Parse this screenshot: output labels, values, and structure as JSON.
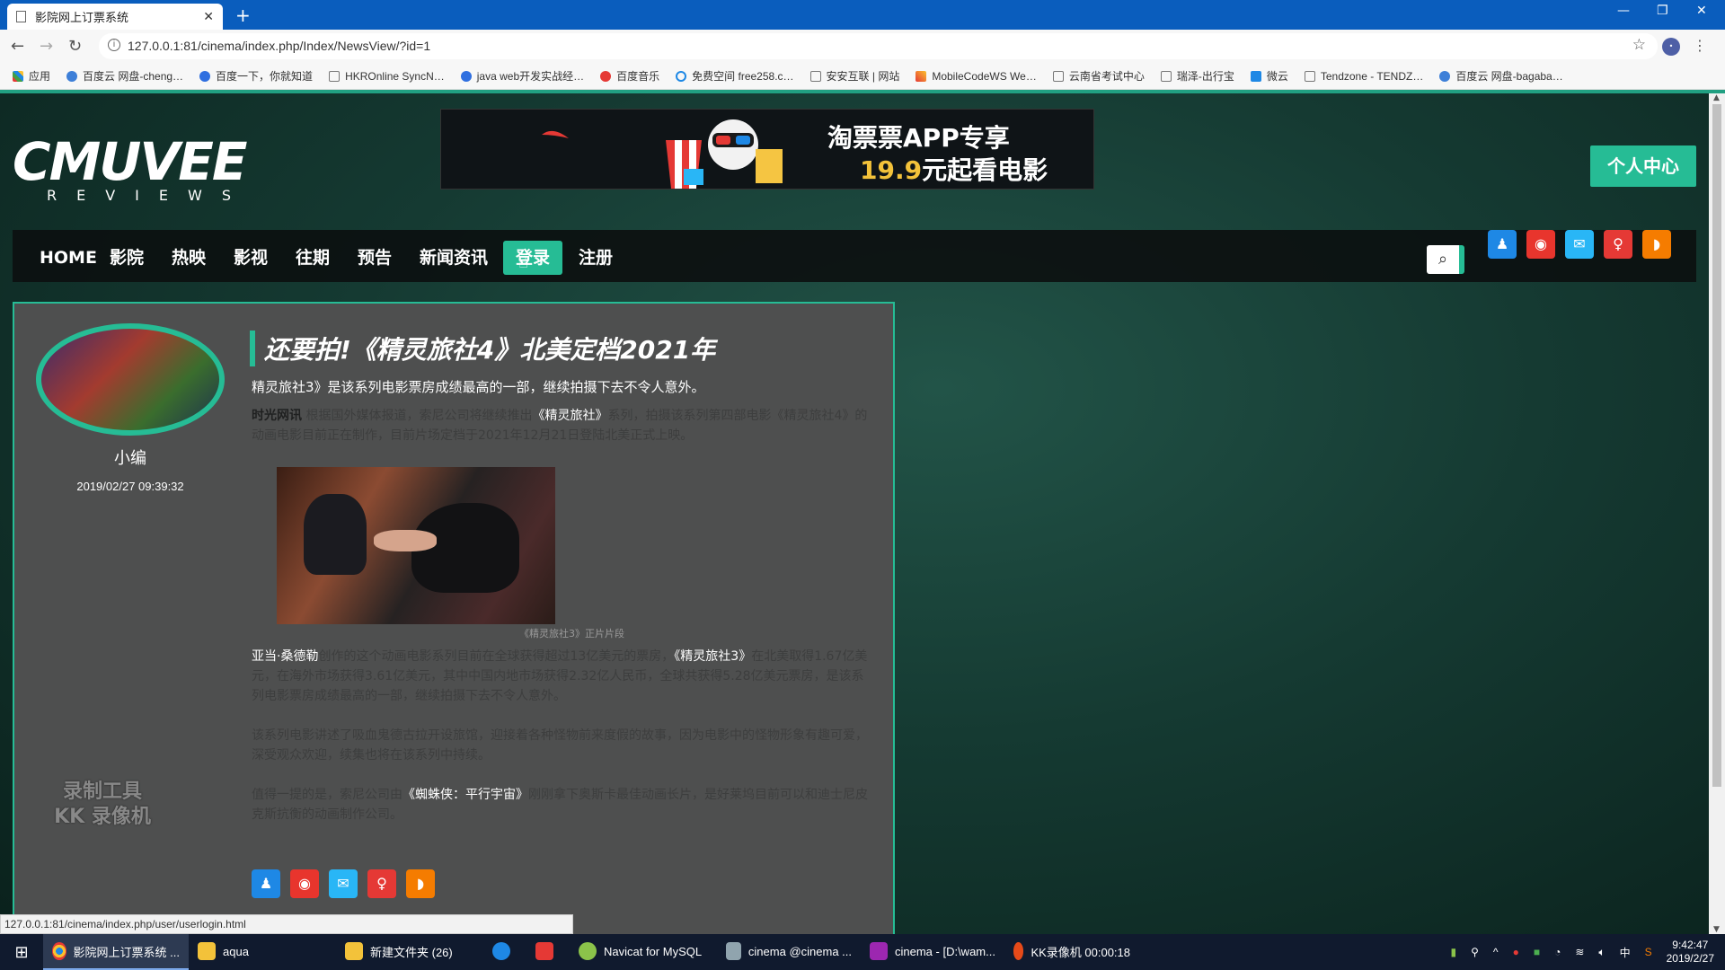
{
  "browser": {
    "tab_title": "影院网上订票系统",
    "url": "127.0.0.1:81/cinema/index.php/Index/NewsView/?id=1",
    "bookmarks": [
      "应用",
      "百度云 网盘-cheng…",
      "百度一下，你就知道",
      "HKROnline SyncN…",
      "java web开发实战经…",
      "百度音乐",
      "免费空间 free258.c…",
      "安安互联 | 网站",
      "MobileCodeWS We…",
      "云南省考试中心",
      "瑞泽-出行宝",
      "微云",
      "Tendzone - TENDZ…",
      "百度云 网盘-bagaba…"
    ],
    "status_url": "127.0.0.1:81/cinema/index.php/user/userlogin.html"
  },
  "site": {
    "logo_main": "CMUVEE",
    "logo_sub": "REVIEWS",
    "banner_line1": "淘票票APP专享",
    "banner_price": "19.9",
    "banner_line2_rest": "元起看电影",
    "user_center": "个人中心",
    "nav": [
      "HOME",
      "影院",
      "热映",
      "影视",
      "往期",
      "预告",
      "新闻资讯",
      "登录",
      "注册"
    ],
    "social_icons": [
      "qq-icon",
      "weibo-icon",
      "wechat-icon",
      "qzone-icon",
      "rss-icon"
    ],
    "colors": {
      "accent": "#26bc95",
      "qq": "#1e88e5",
      "weibo": "#e8352d",
      "wechat": "#29b6f6",
      "qzone": "#e53935",
      "rss": "#f57c00"
    }
  },
  "article": {
    "author": "小编",
    "time": "2019/02/27 09:39:32",
    "title": "还要拍!《精灵旅社4》北美定档2021年",
    "summary": "精灵旅社3》是该系列电影票房成绩最高的一部，继续拍摄下去不令人意外。",
    "p1_lead": "时光网讯",
    "p1_text": "根据国外媒体报道，索尼公司将继续推出",
    "p1_highlight": "《精灵旅社》",
    "p1_rest": "系列，拍摄该系列第四部电影《精灵旅社4》的动画电影目前正在制作，目前片场定档于2021年12月21日登陆北美正式上映。",
    "photo_caption": "《精灵旅社3》正片片段",
    "p2_lead": "亚当·桑德勒",
    "p2_text": "创作的这个动画电影系列目前在全球获得超过13亿美元的票房，",
    "p2_highlight": "《精灵旅社3》",
    "p2_rest": "在北美取得1.67亿美元，在海外市场获得3.61亿美元，其中中国内地市场获得2.32亿人民币，全球共获得5.28亿美元票房，是该系列电影票房成绩最高的一部，继续拍摄下去不令人意外。",
    "p3_text": "该系列电影讲述了吸血鬼德古拉开设旅馆，迎接着各种怪物前来度假的故事，因为电影中的怪物形象有趣可爱，深受观众欢迎，续集也将在该系列中持续。",
    "p4_text": "值得一提的是，索尼公司由",
    "p4_highlight": "《蜘蛛侠：平行宇宙》",
    "p4_rest": "刚刚拿下奥斯卡最佳动画长片，是好莱坞目前可以和迪士尼皮克斯抗衡的动画制作公司。",
    "watermark_line1": "录制工具",
    "watermark_line2": "KK 录像机"
  },
  "taskbar": {
    "items": [
      "影院网上订票系统 ...",
      "aqua",
      "新建文件夹 (26)",
      "",
      "",
      "Navicat for MySQL",
      "cinema @cinema ...",
      "cinema - [D:\\wam...",
      "KK录像机 00:00:18"
    ],
    "ime": "中",
    "time": "9:42:47",
    "date": "2019/2/27"
  }
}
